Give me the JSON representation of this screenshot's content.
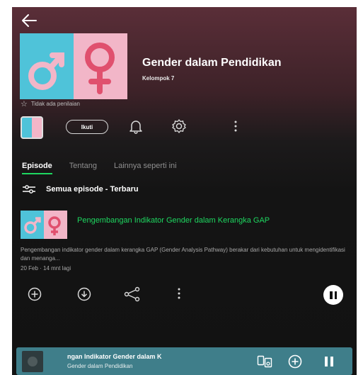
{
  "header": {
    "back_icon": "arrow-left-icon"
  },
  "podcast": {
    "title": "Gender dalam Pendidikan",
    "author": "Kelompok 7",
    "rating_text": "Tidak ada penilaian",
    "follow_label": "Ikuti"
  },
  "tabs": [
    {
      "label": "Episode",
      "active": true
    },
    {
      "label": "Tentang",
      "active": false
    },
    {
      "label": "Lainnya seperti ini",
      "active": false
    }
  ],
  "filter": {
    "label": "Semua episode - Terbaru",
    "icon": "filter-sliders-icon"
  },
  "episode": {
    "title": "Pengembangan Indikator Gender dalam Kerangka GAP",
    "description": "Pengembangan indikator gender dalam kerangka GAP (Gender Analysis Pathway) berakar dari kebutuhan untuk mengidentifikasi dan menanga...",
    "meta": "20 Feb · 14 mnt lagi"
  },
  "mini_player": {
    "title": "ngan Indikator Gender dalam K",
    "subtitle": "Gender dalam Pendidikan"
  },
  "colors": {
    "accent": "#1ed760",
    "background": "#121212",
    "header_tint": "#5a2e38",
    "mini_player": "#3f7e8a",
    "cover_blue": "#4fc3d9",
    "cover_pink": "#f2b6c8"
  }
}
